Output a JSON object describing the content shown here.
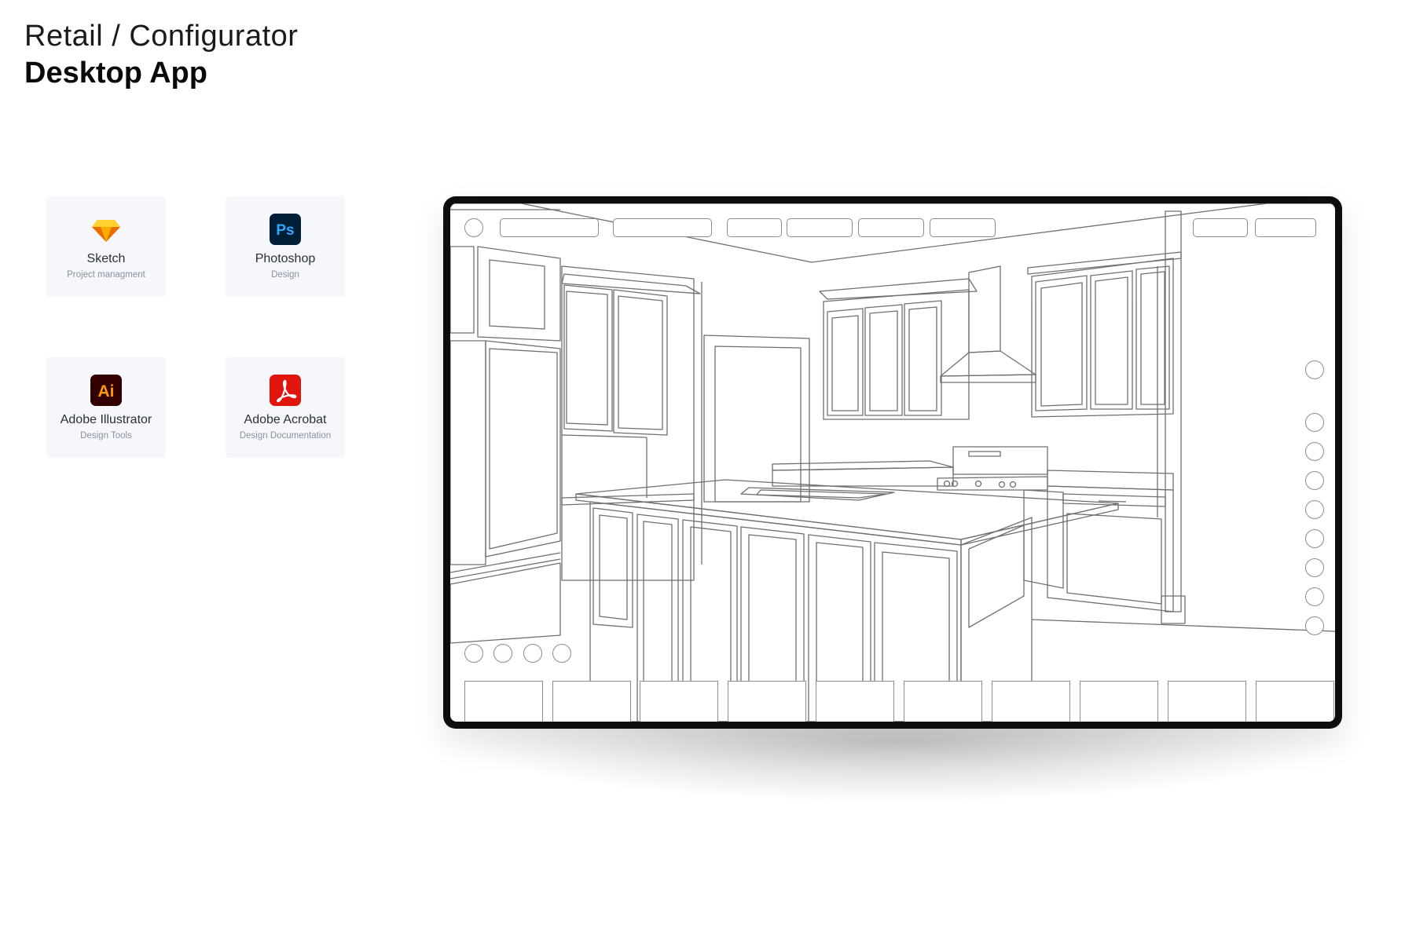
{
  "header": {
    "subtitle": "Retail / Configurator",
    "title": "Desktop App"
  },
  "tools": [
    {
      "name": "Sketch",
      "desc": "Project managment",
      "icon": "sketch-icon"
    },
    {
      "name": "Photoshop",
      "desc": "Design",
      "icon": "photoshop-icon"
    },
    {
      "name": "Adobe Illustrator",
      "desc": "Design Tools",
      "icon": "illustrator-icon"
    },
    {
      "name": "Adobe Acrobat",
      "desc": "Design Documentation",
      "icon": "acrobat-icon"
    }
  ],
  "icon_labels": {
    "photoshop": "Ps",
    "illustrator": "Ai"
  },
  "colors": {
    "sketch": "#fdad00",
    "photoshop_bg": "#001e36",
    "photoshop_fg": "#31a8ff",
    "illustrator_bg": "#330000",
    "illustrator_fg": "#ff9a00",
    "acrobat_bg": "#e0150d",
    "card_bg": "#f6f7fa",
    "device_frame": "#0d0d0d"
  }
}
